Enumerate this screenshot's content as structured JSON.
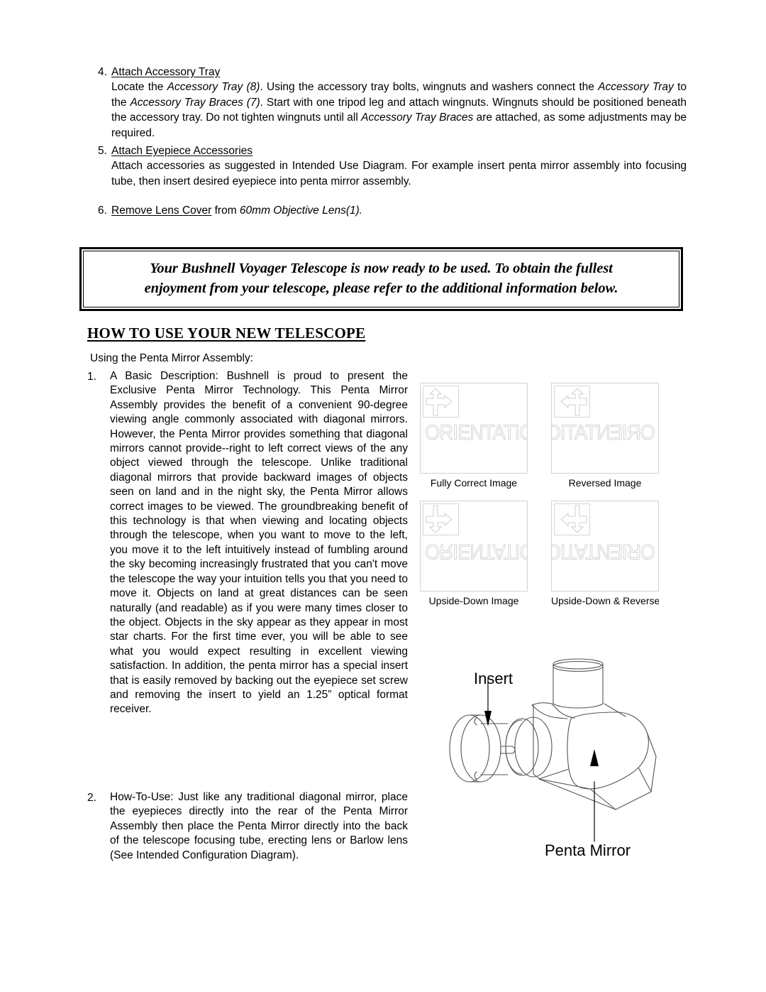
{
  "steps": [
    {
      "number": "4.",
      "title": "Attach Accessory Tray",
      "text_parts": [
        {
          "t": "Locate the ",
          "i": false
        },
        {
          "t": "Accessory Tray (8)",
          "i": true
        },
        {
          "t": ". Using the accessory tray bolts, wingnuts and washers connect the ",
          "i": false
        },
        {
          "t": "Accessory Tray",
          "i": true
        },
        {
          "t": " to the ",
          "i": false
        },
        {
          "t": "Accessory Tray Braces (7)",
          "i": true
        },
        {
          "t": ". Start with one tripod leg and attach wingnuts. Wingnuts should be positioned beneath the accessory tray. Do not tighten wingnuts until all ",
          "i": false
        },
        {
          "t": "Accessory Tray Braces",
          "i": true
        },
        {
          "t": " are attached, as some adjustments may be required.",
          "i": false
        }
      ]
    },
    {
      "number": "5.",
      "title": "Attach Eyepiece Accessories",
      "text_parts": [
        {
          "t": "Attach accessories as suggested in Intended Use Diagram.  For example insert penta mirror assembly into focusing tube, then insert desired eyepiece into penta mirror assembly.",
          "i": false
        }
      ]
    }
  ],
  "step6": {
    "number": "6.",
    "underlined": "Remove Lens Cover",
    "middle": " from ",
    "italic": "60mm Objective Lens(1)."
  },
  "callout": {
    "line1": "Your Bushnell Voyager Telescope is now ready to be used. To obtain the fullest",
    "line2": "enjoyment  from your telescope, please refer to the additional information below."
  },
  "section": {
    "heading": "HOW TO USE YOUR NEW TELESCOPE",
    "intro": "Using the Penta Mirror Assembly:"
  },
  "body_items": [
    {
      "number": "1.",
      "text": "A Basic Description: Bushnell is proud to present the Exclusive Penta Mirror Technology.   This Penta Mirror Assembly provides the benefit of a convenient 90-degree viewing angle commonly associated with diagonal mirrors.  However, the Penta Mirror provides something that diagonal mirrors cannot provide--right to left correct views of the any object viewed through the telescope.  Unlike traditional diagonal mirrors that provide backward images of objects seen on land and in the night sky, the Penta Mirror allows correct images to be viewed.  The groundbreaking benefit of this technology is that when viewing and locating objects through the telescope, when you want to move to the left, you move it to the left intuitively instead of fumbling around the sky becoming increasingly frustrated that you can't move the telescope the way your intuition tells you that you need to move it.  Objects on land at great distances can be seen naturally (and readable) as if you were many times closer to the object.  Objects in the sky appear as they appear in most star charts.  For the first time ever, you will be able to see what you would expect resulting in excellent viewing satisfaction.  In addition, the penta mirror has a special insert that is easily removed by backing out the eyepiece set screw and removing the insert to yield an 1.25” optical format receiver."
    },
    {
      "number": "2.",
      "text": "How-To-Use:  Just like any traditional diagonal mirror, place the eyepieces directly into the rear of the Penta Mirror Assembly then place the Penta Mirror directly into the back of the telescope focusing tube, erecting lens or Barlow lens (See Intended Configuration Diagram)."
    }
  ],
  "orientation_figures": [
    {
      "word": "ORIENTATION",
      "caption": "Fully Correct Image",
      "flip": "none",
      "arrow": "up-right"
    },
    {
      "word": "ORIENTATION",
      "caption": "Reversed Image",
      "flip": "h",
      "arrow": "up-left"
    },
    {
      "word": "ORIENTATION",
      "caption": "Upside-Down Image",
      "flip": "v",
      "arrow": "down-right"
    },
    {
      "word": "ORIENTATION",
      "caption": "Upside-Down & Reversed Ima",
      "flip": "hv",
      "arrow": "down-left"
    }
  ],
  "penta_diagram": {
    "label_insert": "Insert",
    "label_penta": "Penta Mirror"
  },
  "colors": {
    "ink": "#000000",
    "page": "#ffffff",
    "figure_line": "#d2d2d2",
    "diagram_line": "#4a4a4a"
  }
}
